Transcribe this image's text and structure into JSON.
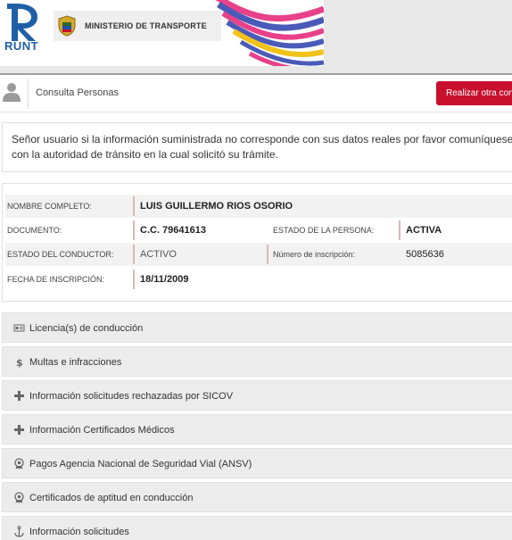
{
  "header": {
    "runt_label": "RUNT",
    "ministry_label": "MINISTERIO DE TRANSPORTE"
  },
  "topbar": {
    "title": "Consulta Personas",
    "action_button": "Realizar otra cons"
  },
  "notice": {
    "line1": "Señor usuario si la información suministrada no corresponde con sus datos reales por favor comuníquese",
    "line2": "con la autoridad de tránsito en la cual solicitó su trámite."
  },
  "person": {
    "nombre_label": "NOMBRE COMPLETO:",
    "nombre_value": "LUIS GUILLERMO RIOS OSORIO",
    "documento_label": "DOCUMENTO:",
    "documento_value": "C.C. 79641613",
    "estado_persona_label": "ESTADO DE LA PERSONA:",
    "estado_persona_value": "ACTIVA",
    "estado_conductor_label": "ESTADO DEL CONDUCTOR:",
    "estado_conductor_value": "ACTIVO",
    "inscripcion_num_label": "Número de inscripción:",
    "inscripcion_num_value": "5085636",
    "fecha_label": "FECHA DE INSCRIPCIÓN:",
    "fecha_value": "18/11/2009"
  },
  "sections": [
    {
      "label": "Licencia(s) de conducción",
      "icon": "id-card-icon"
    },
    {
      "label": "Multas e infracciones",
      "icon": "dollar-icon"
    },
    {
      "label": "Información solicitudes rechazadas por SICOV",
      "icon": "plus-icon"
    },
    {
      "label": "Información Certificados Médicos",
      "icon": "plus-icon"
    },
    {
      "label": "Pagos Agencia Nacional de Seguridad Vial (ANSV)",
      "icon": "badge-icon"
    },
    {
      "label": "Certificados de aptitud en conducción",
      "icon": "badge-icon"
    },
    {
      "label": "Información solicitudes",
      "icon": "anchor-icon"
    }
  ],
  "colors": {
    "accent_red": "#c8102e",
    "runt_blue": "#1f5fa8",
    "section_bg": "#ececec"
  }
}
